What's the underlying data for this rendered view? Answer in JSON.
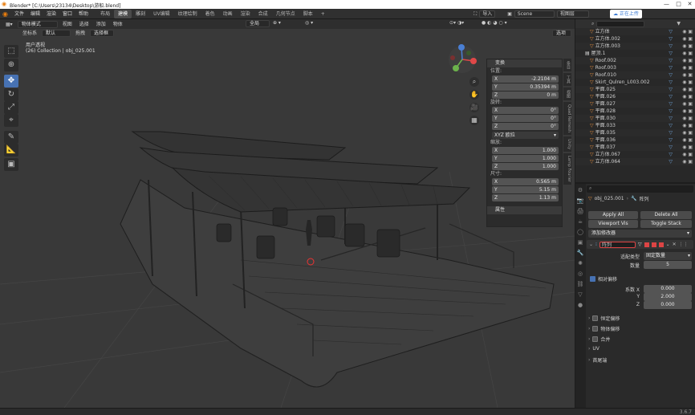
{
  "window": {
    "title": "Blender* [C:\\Users\\23134\\Desktop\\游船.blend]",
    "min": "—",
    "max": "□",
    "close": "✕"
  },
  "menus": [
    "文件",
    "编辑",
    "渲染",
    "窗口",
    "帮助"
  ],
  "workspaces": [
    "布局",
    "建模",
    "雕刻",
    "UV编辑",
    "纹理绘制",
    "着色",
    "动画",
    "渲染",
    "合成",
    "几何节点",
    "脚本"
  ],
  "active_workspace": "建模",
  "topright": {
    "scene_label": "Scene",
    "import_label": "导入",
    "view_layer_label": "视图层",
    "tooltip": "正在上传"
  },
  "viewport_header": {
    "mode": "物体模式",
    "menus": [
      "视图",
      "选择",
      "添加",
      "物体"
    ],
    "orientation_label": "坐标系",
    "orientation_value": "默认",
    "drag_label": "拖拽",
    "drag_value": "选择框",
    "pivot_value": "全局",
    "options_label": "选项"
  },
  "viewport_info": {
    "line1": "用户透视",
    "line2": "(26) Collection | obj_025.001"
  },
  "npanel": {
    "transform_title": "变换",
    "location_label": "位置:",
    "location": [
      {
        "axis": "X",
        "value": "-2.2104 m"
      },
      {
        "axis": "Y",
        "value": "0.35394 m"
      },
      {
        "axis": "Z",
        "value": "0 m"
      }
    ],
    "rotation_label": "旋转:",
    "rotation": [
      {
        "axis": "X",
        "value": "0°"
      },
      {
        "axis": "Y",
        "value": "0°"
      },
      {
        "axis": "Z",
        "value": "0°"
      }
    ],
    "rotation_mode": "XYZ 欧拉",
    "scale_label": "缩放:",
    "scale": [
      {
        "axis": "X",
        "value": "1.000"
      },
      {
        "axis": "Y",
        "value": "1.000"
      },
      {
        "axis": "Z",
        "value": "1.000"
      }
    ],
    "dimensions_label": "尺寸:",
    "dimensions": [
      {
        "axis": "X",
        "value": "0.565 m"
      },
      {
        "axis": "Y",
        "value": "5.15 m"
      },
      {
        "axis": "Z",
        "value": "1.13 m"
      }
    ],
    "properties_title": "属性",
    "tabs": [
      "条目",
      "工具",
      "视图",
      "Quad Remesh",
      "Unity",
      "Lamp Fourier"
    ]
  },
  "outliner": {
    "search_placeholder": "",
    "items": [
      {
        "name": "立方体",
        "icon": "mesh-icon",
        "selected": false
      },
      {
        "name": "立方体.002",
        "icon": "mesh-icon",
        "selected": false
      },
      {
        "name": "立方体.003",
        "icon": "mesh-icon",
        "selected": false
      },
      {
        "name": "屋顶.1",
        "icon": "collection-icon",
        "selected": false
      },
      {
        "name": "Roof.002",
        "icon": "mesh-icon",
        "selected": false
      },
      {
        "name": "Roof.003",
        "icon": "mesh-icon",
        "selected": false
      },
      {
        "name": "Roof.010",
        "icon": "mesh-icon",
        "selected": false
      },
      {
        "name": "Skirt_Qulren_L003.002",
        "icon": "mesh-icon",
        "selected": false
      },
      {
        "name": "平面.025",
        "icon": "mesh-icon",
        "selected": false
      },
      {
        "name": "平面.026",
        "icon": "mesh-icon",
        "selected": false
      },
      {
        "name": "平面.027",
        "icon": "mesh-icon",
        "selected": false
      },
      {
        "name": "平面.028",
        "icon": "mesh-icon",
        "selected": false
      },
      {
        "name": "平面.030",
        "icon": "mesh-icon",
        "selected": false
      },
      {
        "name": "平面.033",
        "icon": "mesh-icon",
        "selected": false
      },
      {
        "name": "平面.035",
        "icon": "mesh-icon",
        "selected": false
      },
      {
        "name": "平面.036",
        "icon": "mesh-icon",
        "selected": false
      },
      {
        "name": "平面.037",
        "icon": "mesh-icon",
        "selected": false
      },
      {
        "name": "立方体.067",
        "icon": "mesh-icon",
        "selected": false
      },
      {
        "name": "立方体.064",
        "icon": "mesh-icon",
        "selected": false
      }
    ]
  },
  "properties": {
    "object_name": "obj_025.001",
    "modifier_set": "阵列",
    "apply_all": "Apply All",
    "delete_all": "Delete All",
    "viewport_vis": "Viewport Vis",
    "toggle_stack": "Toggle Stack",
    "add_modifier": "添加修改器",
    "modifier_name": "阵列",
    "fit_type_label": "适配类型",
    "fit_type_value": "固定数量",
    "count_label": "数量",
    "count_value": "5",
    "relative_offset": "相对偏移",
    "factor_x_label": "系数 X",
    "factor_x": "0.000",
    "factor_y_label": "Y",
    "factor_y": "2.000",
    "factor_z_label": "Z",
    "factor_z": "0.000",
    "const_offset": "恒定偏移",
    "obj_offset": "物体偏移",
    "merge": "合并",
    "uv": "UV",
    "caps": "首尾端"
  },
  "status": {
    "version": "3.6.7"
  }
}
